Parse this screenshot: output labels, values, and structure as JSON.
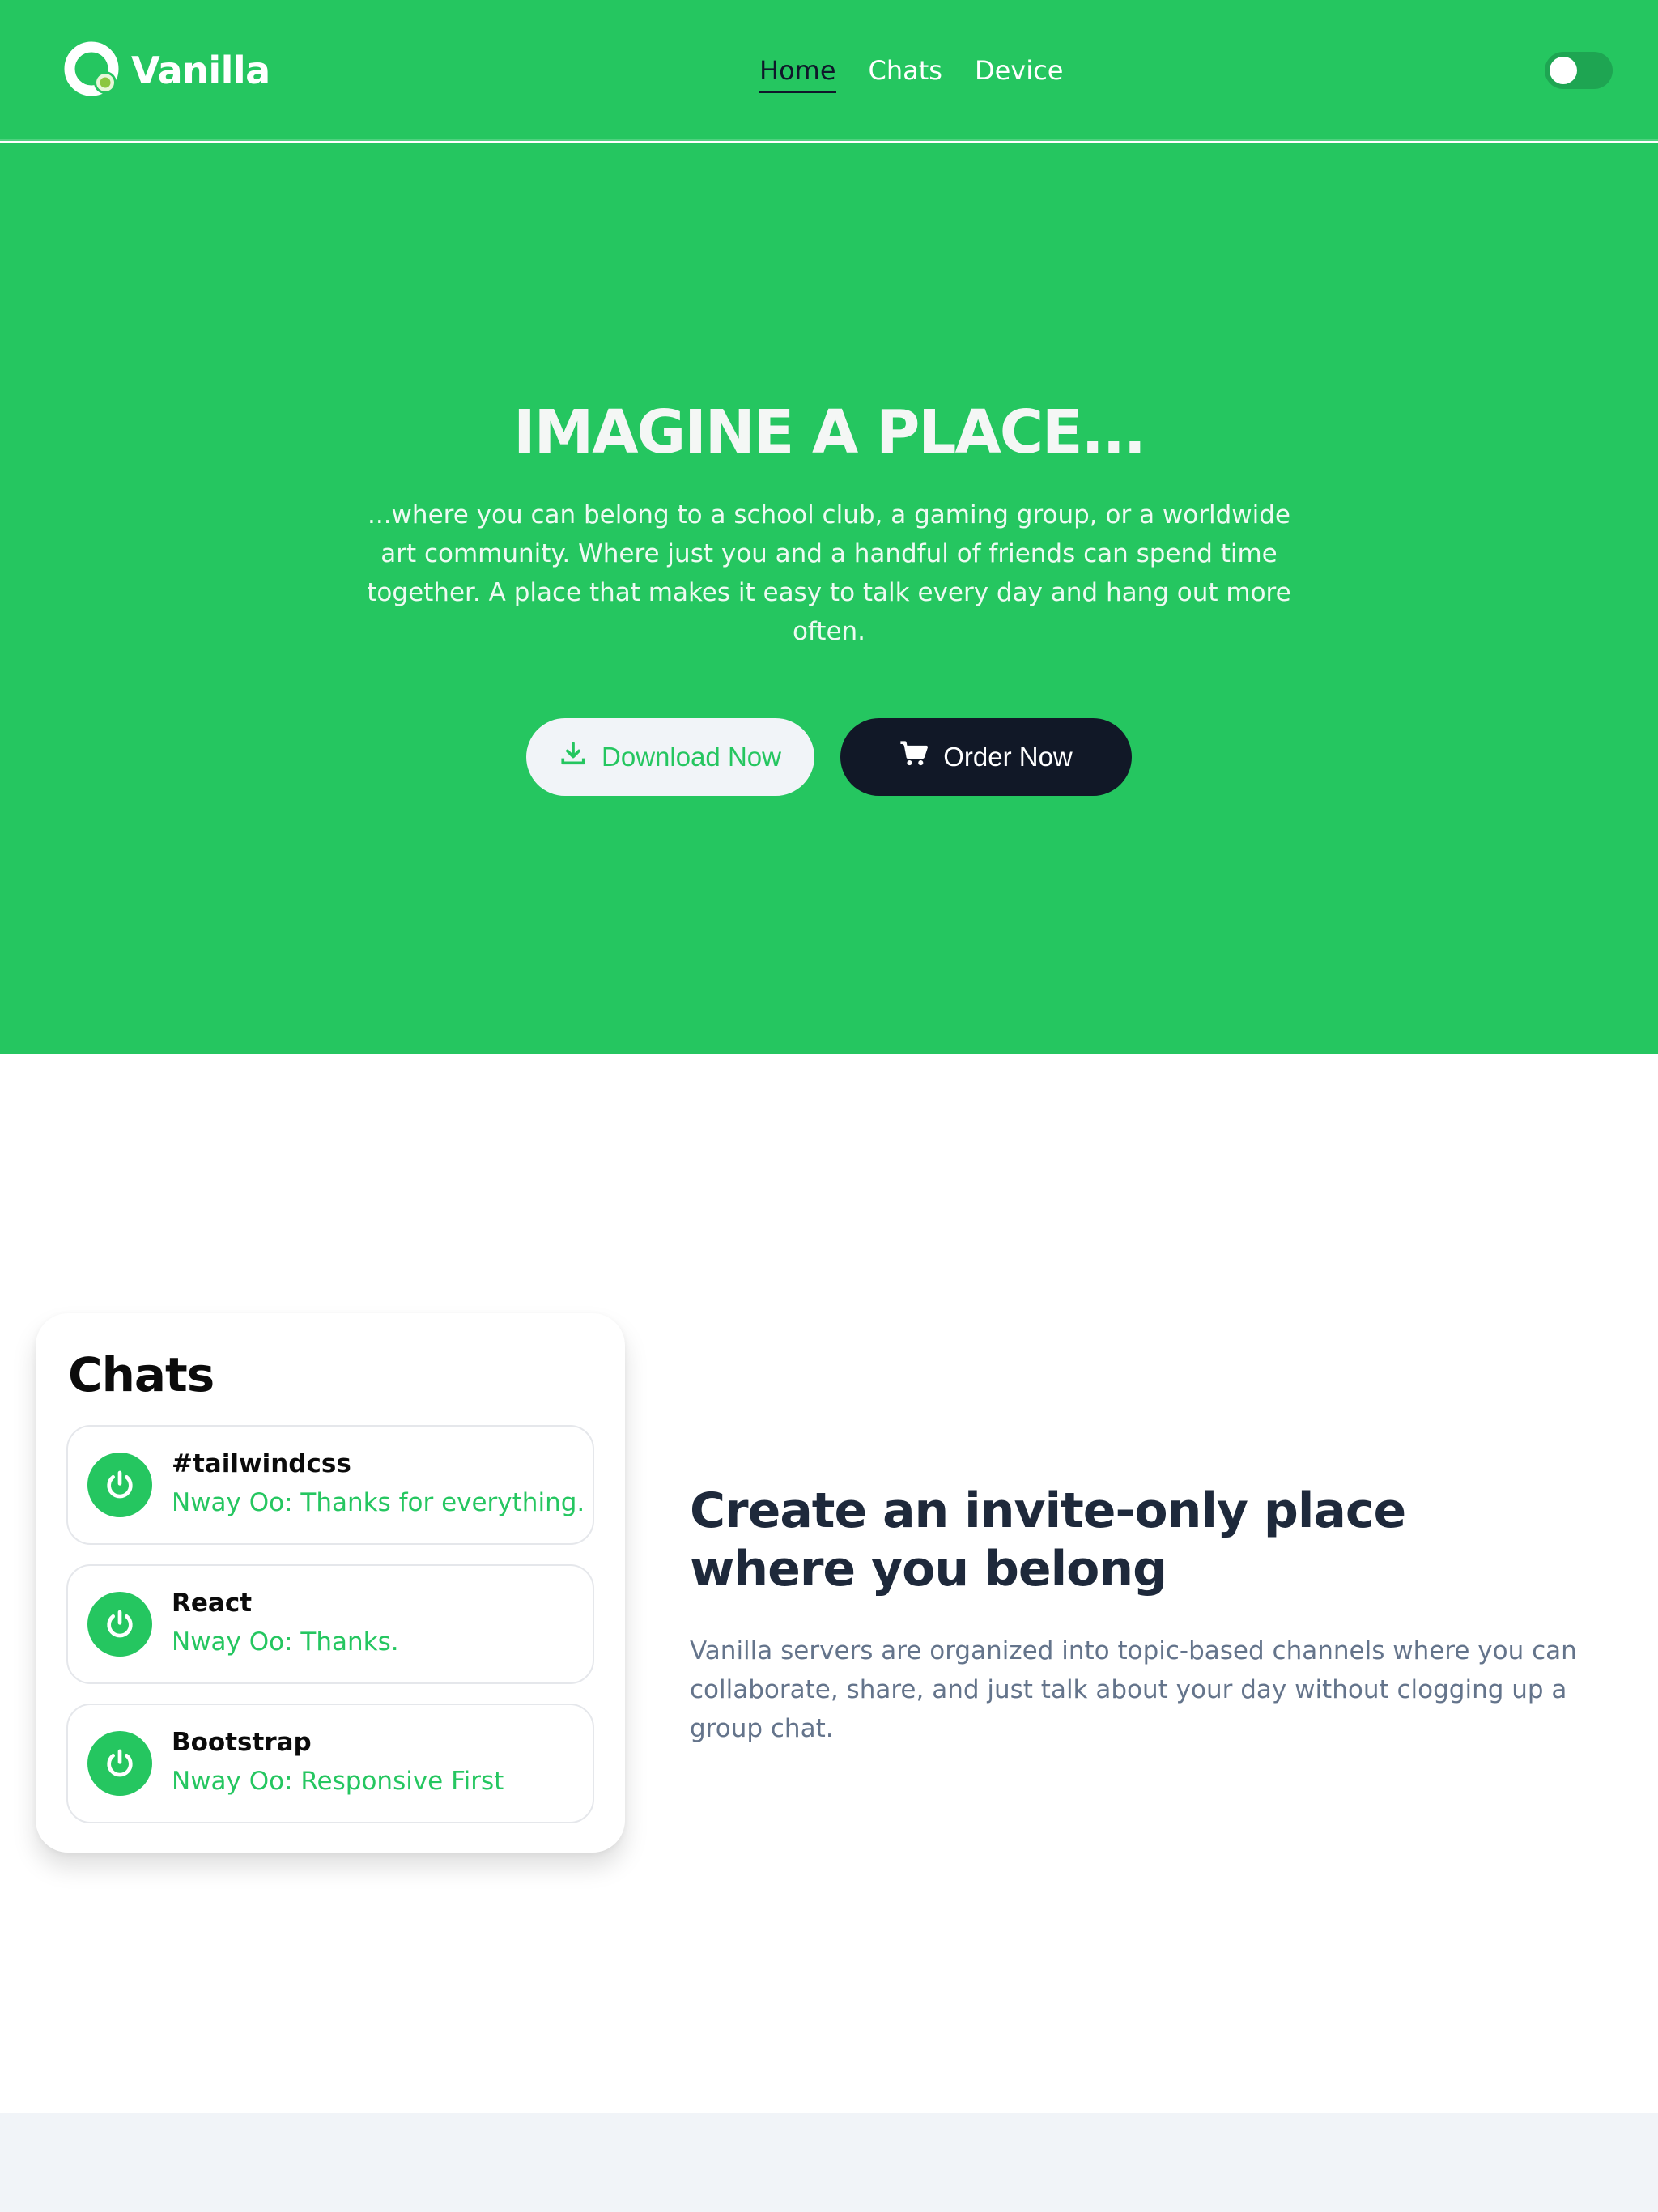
{
  "brand": {
    "name": "Vanilla"
  },
  "colors": {
    "primary": "#25c660",
    "dark": "#111827",
    "light": "#f1f4f8",
    "muted": "#64748b"
  },
  "nav": {
    "items": [
      {
        "label": "Home",
        "active": true
      },
      {
        "label": "Chats",
        "active": false
      },
      {
        "label": "Device",
        "active": false
      }
    ],
    "theme_toggle": {
      "state": "off"
    }
  },
  "hero": {
    "title": "IMAGINE A PLACE...",
    "text": "...where you can belong to a school club, a gaming group, or a worldwide art community. Where just you and a handful of friends can spend time together. A place that makes it easy to talk every day and hang out more often.",
    "buttons": [
      {
        "label": "Download Now",
        "icon": "download-icon"
      },
      {
        "label": "Order Now",
        "icon": "cart-icon"
      }
    ]
  },
  "chats_card": {
    "title": "Chats",
    "items": [
      {
        "name": "#tailwindcss",
        "message": "Nway Oo: Thanks for everything.",
        "icon": "power-icon"
      },
      {
        "name": "React",
        "message": "Nway Oo: Thanks.",
        "icon": "power-icon"
      },
      {
        "name": "Bootstrap",
        "message": "Nway Oo: Responsive First",
        "icon": "power-icon"
      }
    ]
  },
  "feature": {
    "title_line1": "Create an invite-only place",
    "title_line2": "where you belong",
    "text": "Vanilla servers are organized into topic-based channels where you can collaborate, share, and just talk about your day without clogging up a group chat."
  }
}
